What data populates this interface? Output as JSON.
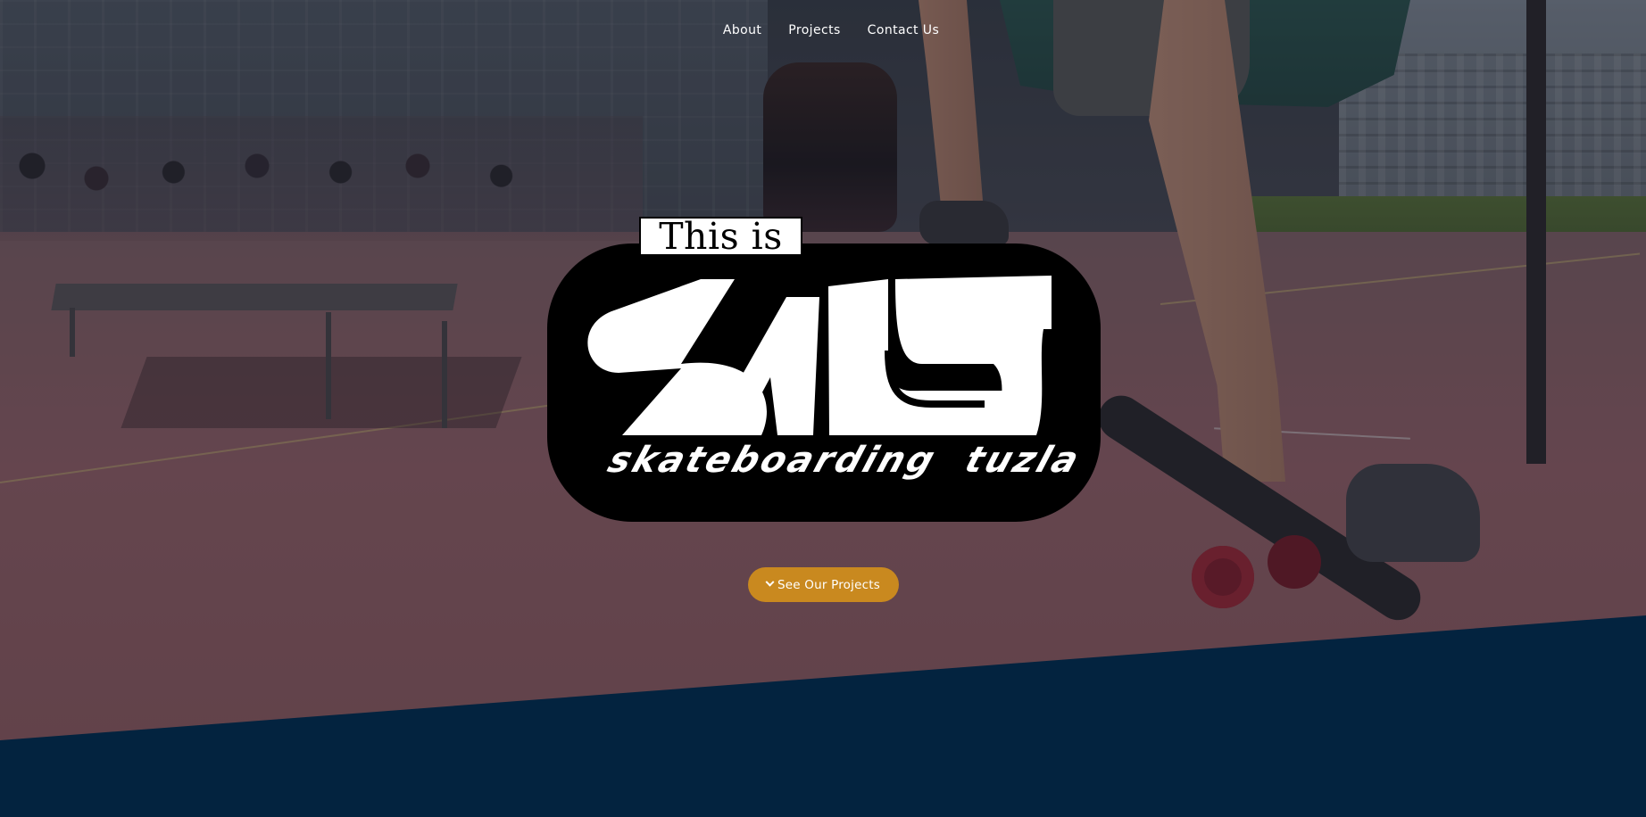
{
  "nav": {
    "items": [
      {
        "label": "About"
      },
      {
        "label": "Projects"
      },
      {
        "label": "Contact Us"
      }
    ]
  },
  "hero": {
    "logo": {
      "tag_text": "This is",
      "wordmark": "SALT",
      "subtitle": "skateboarding tuzla"
    },
    "cta": {
      "label": "See Our Projects",
      "icon": "chevron-down-icon"
    }
  },
  "colors": {
    "accent": "#c9891f",
    "section_bg": "#03233f",
    "logo_bg": "#000000",
    "logo_fg": "#ffffff"
  }
}
